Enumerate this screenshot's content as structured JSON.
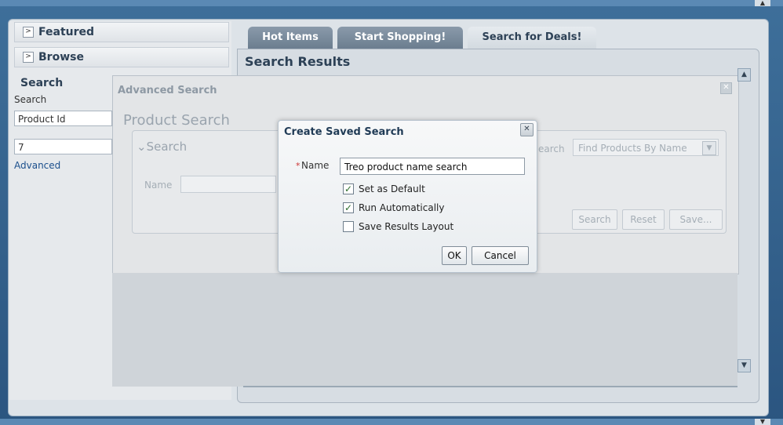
{
  "window": {
    "accent": "#2e5d86"
  },
  "left": {
    "featured": {
      "label": "Featured",
      "icon": "chevron-right-icon"
    },
    "browse": {
      "label": "Browse",
      "icon": "chevron-right-icon"
    },
    "search_header": "Search",
    "search_label": "Search",
    "search_field_value": "Product Id",
    "id_value": "7",
    "advanced_link": "Advanced"
  },
  "tabs": [
    {
      "label": "Hot Items"
    },
    {
      "label": "Start Shopping!"
    },
    {
      "label": "Search for Deals!",
      "active": true
    }
  ],
  "results_title": "Search Results",
  "advanced": {
    "title": "Advanced Search",
    "subtitle": "Product Search",
    "search_toggle": "Search",
    "name_label": "Name",
    "saved_search_label_partial": "earch",
    "saved_search_select": "Find Products By Name",
    "buttons": {
      "search": "Search",
      "reset": "Reset",
      "save": "Save..."
    }
  },
  "modal": {
    "title": "Create Saved Search",
    "required_marker": "*",
    "name_label": "Name",
    "name_value": "Treo product name search",
    "checkboxes": [
      {
        "label": "Set as Default",
        "checked": true
      },
      {
        "label": "Run Automatically",
        "checked": true
      },
      {
        "label": "Save Results Layout",
        "checked": false
      }
    ],
    "ok_label": "OK",
    "cancel_label": "Cancel"
  }
}
